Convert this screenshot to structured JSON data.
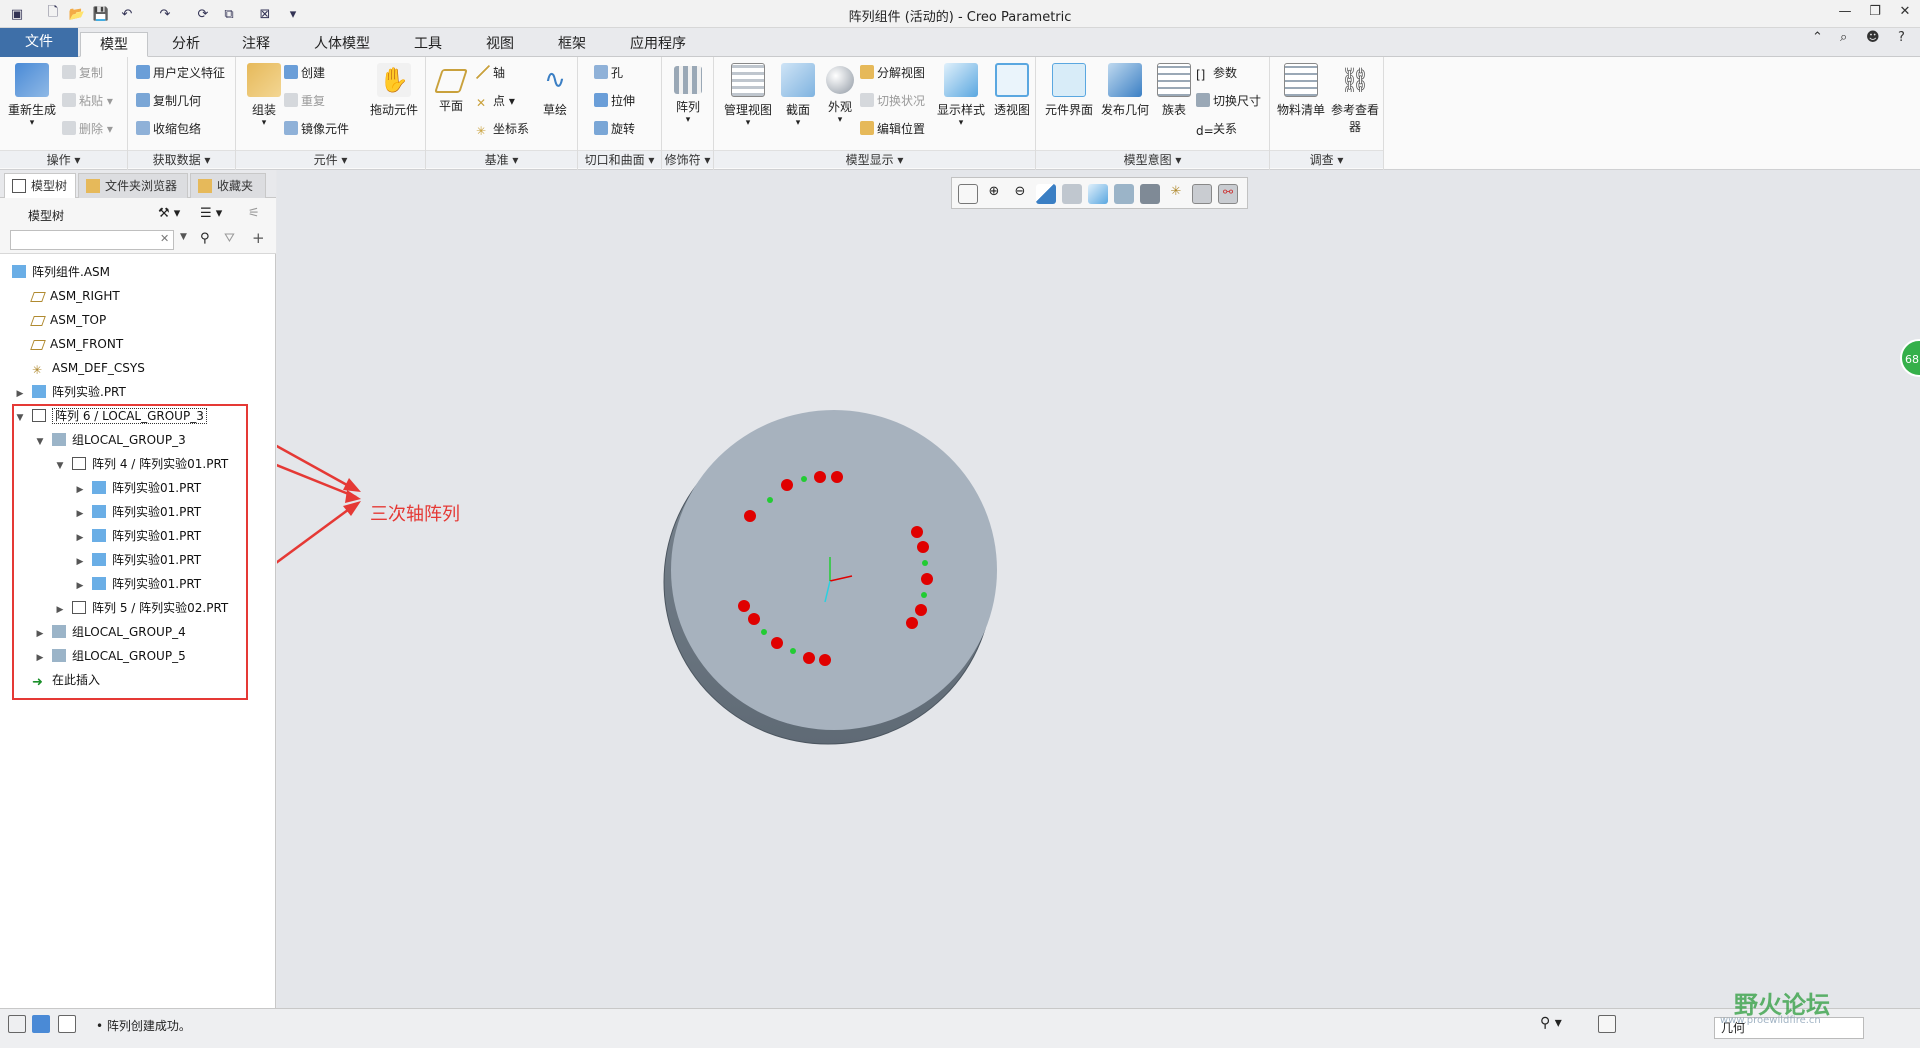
{
  "window": {
    "title": "阵列组件 (活动的) - Creo Parametric"
  },
  "tabs": [
    {
      "label": "文件"
    },
    {
      "label": "模型"
    },
    {
      "label": "分析"
    },
    {
      "label": "注释"
    },
    {
      "label": "人体模型"
    },
    {
      "label": "工具"
    },
    {
      "label": "视图"
    },
    {
      "label": "框架"
    },
    {
      "label": "应用程序"
    }
  ],
  "ribbon": {
    "operations": {
      "regenerate": "重新生成",
      "copy": "复制",
      "paste": "粘贴",
      "delete": "删除",
      "group": "操作"
    },
    "get_data": {
      "udf": "用户定义特征",
      "copy_geom": "复制几何",
      "shrinkwrap": "收缩包络",
      "group": "获取数据"
    },
    "component": {
      "assemble": "组装",
      "create": "创建",
      "repeat": "重复",
      "mirror": "镜像元件",
      "drag": "拖动元件",
      "group": "元件"
    },
    "datum": {
      "plane": "平面",
      "axis": "轴",
      "point": "点",
      "csys": "坐标系",
      "sketch": "草绘",
      "group": "基准"
    },
    "cut_surface": {
      "hole": "孔",
      "extrude": "拉伸",
      "revolve": "旋转",
      "group": "切口和曲面"
    },
    "modifiers": {
      "pattern": "阵列",
      "group": "修饰符"
    },
    "model_display": {
      "manage_views": "管理视图",
      "section": "截面",
      "appearance": "外观",
      "explode": "分解视图",
      "toggle_status": "切换状况",
      "edit_position": "编辑位置",
      "display_style": "显示样式",
      "perspective": "透视图",
      "group": "模型显示"
    },
    "model_intent": {
      "component_interface": "元件界面",
      "publish_geom": "发布几何",
      "family_table": "族表",
      "params": "参数",
      "switch_dims": "切换尺寸",
      "relations": "关系",
      "group": "模型意图"
    },
    "investigate": {
      "bom": "物料清单",
      "ref_viewer": "参考查看器",
      "group": "调查"
    }
  },
  "panel": {
    "tabs": [
      "模型树",
      "文件夹浏览器",
      "收藏夹"
    ],
    "tree_label": "模型树",
    "search_placeholder": ""
  },
  "tree": [
    {
      "label": "阵列组件.ASM",
      "expander": ""
    },
    {
      "label": "ASM_RIGHT",
      "expander": ""
    },
    {
      "label": "ASM_TOP",
      "expander": ""
    },
    {
      "label": "ASM_FRONT",
      "expander": ""
    },
    {
      "label": "ASM_DEF_CSYS",
      "expander": ""
    },
    {
      "label": "阵列实验.PRT",
      "expander": "▶"
    },
    {
      "label": "阵列 6 / LOCAL_GROUP_3",
      "expander": "▼"
    },
    {
      "label": "组LOCAL_GROUP_3",
      "expander": "▼"
    },
    {
      "label": "阵列 4 / 阵列实验01.PRT",
      "expander": "▼"
    },
    {
      "label": "阵列实验01.PRT",
      "expander": "▶"
    },
    {
      "label": "阵列实验01.PRT",
      "expander": "▶"
    },
    {
      "label": "阵列实验01.PRT",
      "expander": "▶"
    },
    {
      "label": "阵列实验01.PRT",
      "expander": "▶"
    },
    {
      "label": "阵列实验01.PRT",
      "expander": "▶"
    },
    {
      "label": "阵列 5 / 阵列实验02.PRT",
      "expander": "▶"
    },
    {
      "label": "组LOCAL_GROUP_4",
      "expander": "▶"
    },
    {
      "label": "组LOCAL_GROUP_5",
      "expander": "▶"
    },
    {
      "label": "在此插入",
      "expander": ""
    }
  ],
  "annotation": {
    "text": "三次轴阵列"
  },
  "status": {
    "message": "• 阵列创建成功。",
    "filter": "几何"
  },
  "watermark": {
    "text": "野火论坛",
    "url": "www.proewildfire.cn"
  },
  "badge": {
    "text": "68"
  },
  "colors": {
    "accent": "#3e6fa8",
    "highlight": "#e53935",
    "disk": "#a7b2be"
  }
}
